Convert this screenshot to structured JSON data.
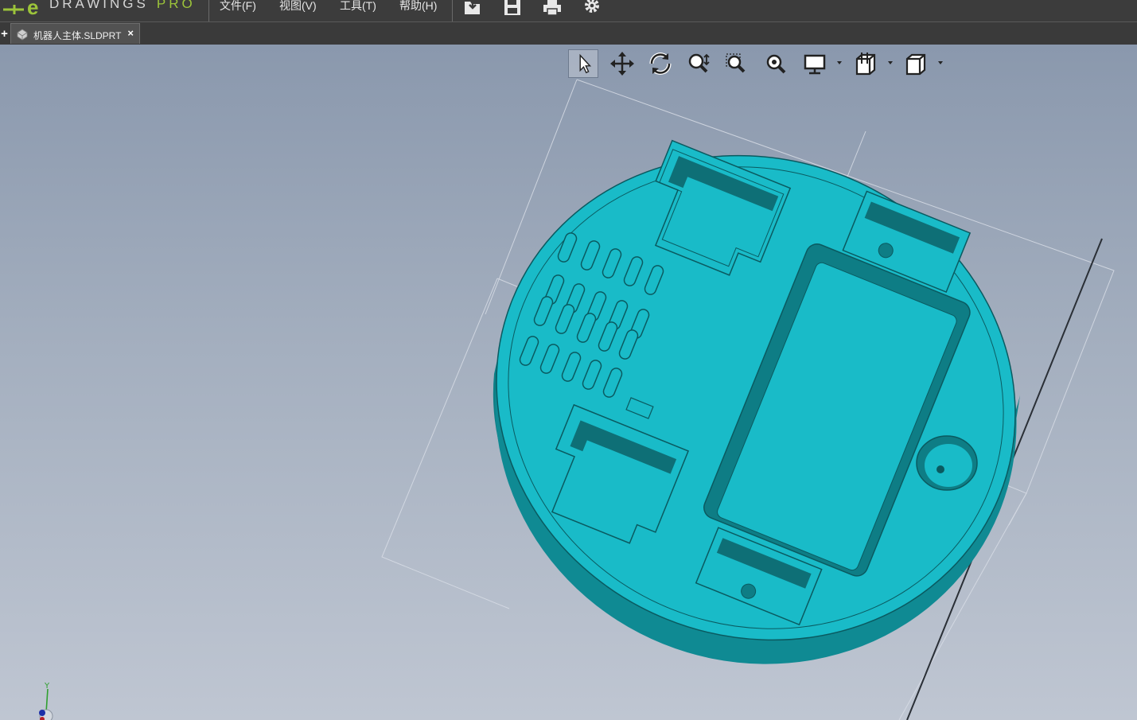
{
  "app": {
    "logo_word": "DRAWINGS",
    "logo_pro": "PRO",
    "accent_color": "#9cc43a"
  },
  "menu": {
    "items": [
      {
        "label": "文件(F)"
      },
      {
        "label": "视图(V)"
      },
      {
        "label": "工具(T)"
      },
      {
        "label": "帮助(H)"
      }
    ],
    "toolbar_icons": [
      "open-icon",
      "save-icon",
      "print-icon",
      "settings-icon"
    ]
  },
  "tabs": {
    "new_tab_label": "+",
    "active_tab": {
      "label": "机器人主体.SLDPRT",
      "close": "×",
      "icon": "part-icon"
    }
  },
  "heads_up_toolbar": {
    "buttons": [
      "select-icon",
      "pan-icon",
      "rotate-icon",
      "zoom-icon",
      "zoom-to-area-icon",
      "zoom-to-fit-icon",
      "display-style-icon",
      "section-view-icon",
      "standard-views-icon"
    ]
  },
  "viewport": {
    "model_color": "#19bbc8",
    "model_dark_color": "#0d7f86",
    "triad_label_y": "Y"
  }
}
